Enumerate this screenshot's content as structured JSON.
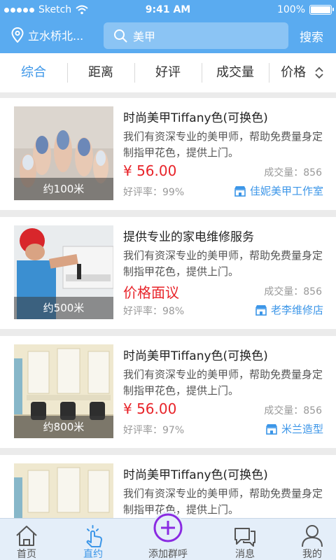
{
  "status": {
    "carrier": "Sketch",
    "time": "9:41 AM",
    "battery": "100%"
  },
  "header": {
    "location": "立水桥北...",
    "search_value": "美甲",
    "search_button": "搜索"
  },
  "tabs": [
    {
      "label": "综合",
      "active": true
    },
    {
      "label": "距离"
    },
    {
      "label": "好评"
    },
    {
      "label": "成交量"
    },
    {
      "label": "价格"
    }
  ],
  "items": [
    {
      "distance": "约100米",
      "title": "时尚美甲Tiffany色(可换色)",
      "desc": "我们有资深专业的美甲师，帮助免费量身定制指甲花色，提供上门。",
      "price": "¥ 56.00",
      "sales": "成交量：856",
      "rating": "好评率：99%",
      "shop": "佳妮美甲工作室"
    },
    {
      "distance": "约500米",
      "title": "提供专业的家电维修服务",
      "desc": "我们有资深专业的美甲师，帮助免费量身定制指甲花色，提供上门。",
      "price": "价格面议",
      "sales": "成交量：856",
      "rating": "好评率：98%",
      "shop": "老李维修店"
    },
    {
      "distance": "约800米",
      "title": "时尚美甲Tiffany色(可换色)",
      "desc": "我们有资深专业的美甲师，帮助免费量身定制指甲花色，提供上门。",
      "price": "¥ 56.00",
      "sales": "成交量：856",
      "rating": "好评率：97%",
      "shop": "米兰造型"
    },
    {
      "title": "时尚美甲Tiffany色(可换色)",
      "desc": "我们有资深专业的美甲师，帮助免费量身定制指甲花色，提供上门。"
    }
  ],
  "tabbar": [
    {
      "label": "首页",
      "icon": "home-icon"
    },
    {
      "label": "直约",
      "icon": "tap-icon",
      "active": true
    },
    {
      "label": "添加群呼",
      "icon": "plus-circle-icon"
    },
    {
      "label": "消息",
      "icon": "chat-icon"
    },
    {
      "label": "我的",
      "icon": "user-icon"
    }
  ],
  "colors": {
    "brand": "#5aabf0",
    "accent": "#3c96e8",
    "price": "#e8242a",
    "plus": "#8a2be2"
  }
}
